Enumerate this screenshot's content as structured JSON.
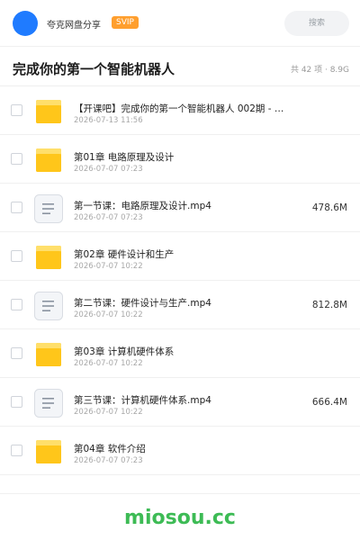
{
  "header": {
    "brand_name": "夸克网盘分享",
    "badge": "SVIP",
    "search_label": "搜索",
    "accent_color": "#1f7bff"
  },
  "title": {
    "text": "完成你的第一个智能机器人",
    "meta": "共 42 项 · 8.9G"
  },
  "files": [
    {
      "type": "folder",
      "name": "【开课吧】完成你的第一个智能机器人 002期 - …",
      "date": "2026-07-13 11:56",
      "size": ""
    },
    {
      "type": "folder",
      "name": "第01章 电路原理及设计",
      "date": "2026-07-07 07:23",
      "size": ""
    },
    {
      "type": "doc",
      "name": "第一节课：电路原理及设计.mp4",
      "date": "2026-07-07 07:23",
      "size": "478.6M"
    },
    {
      "type": "folder",
      "name": "第02章 硬件设计和生产",
      "date": "2026-07-07 10:22",
      "size": ""
    },
    {
      "type": "doc",
      "name": "第二节课：硬件设计与生产.mp4",
      "date": "2026-07-07 10:22",
      "size": "812.8M"
    },
    {
      "type": "folder",
      "name": "第03章 计算机硬件体系",
      "date": "2026-07-07 10:22",
      "size": ""
    },
    {
      "type": "doc",
      "name": "第三节课：计算机硬件体系.mp4",
      "date": "2026-07-07 10:22",
      "size": "666.4M"
    },
    {
      "type": "folder",
      "name": "第04章 软件介绍",
      "date": "2026-07-07 07:23",
      "size": ""
    }
  ],
  "footer": {
    "watermark": "miosou.cc"
  }
}
